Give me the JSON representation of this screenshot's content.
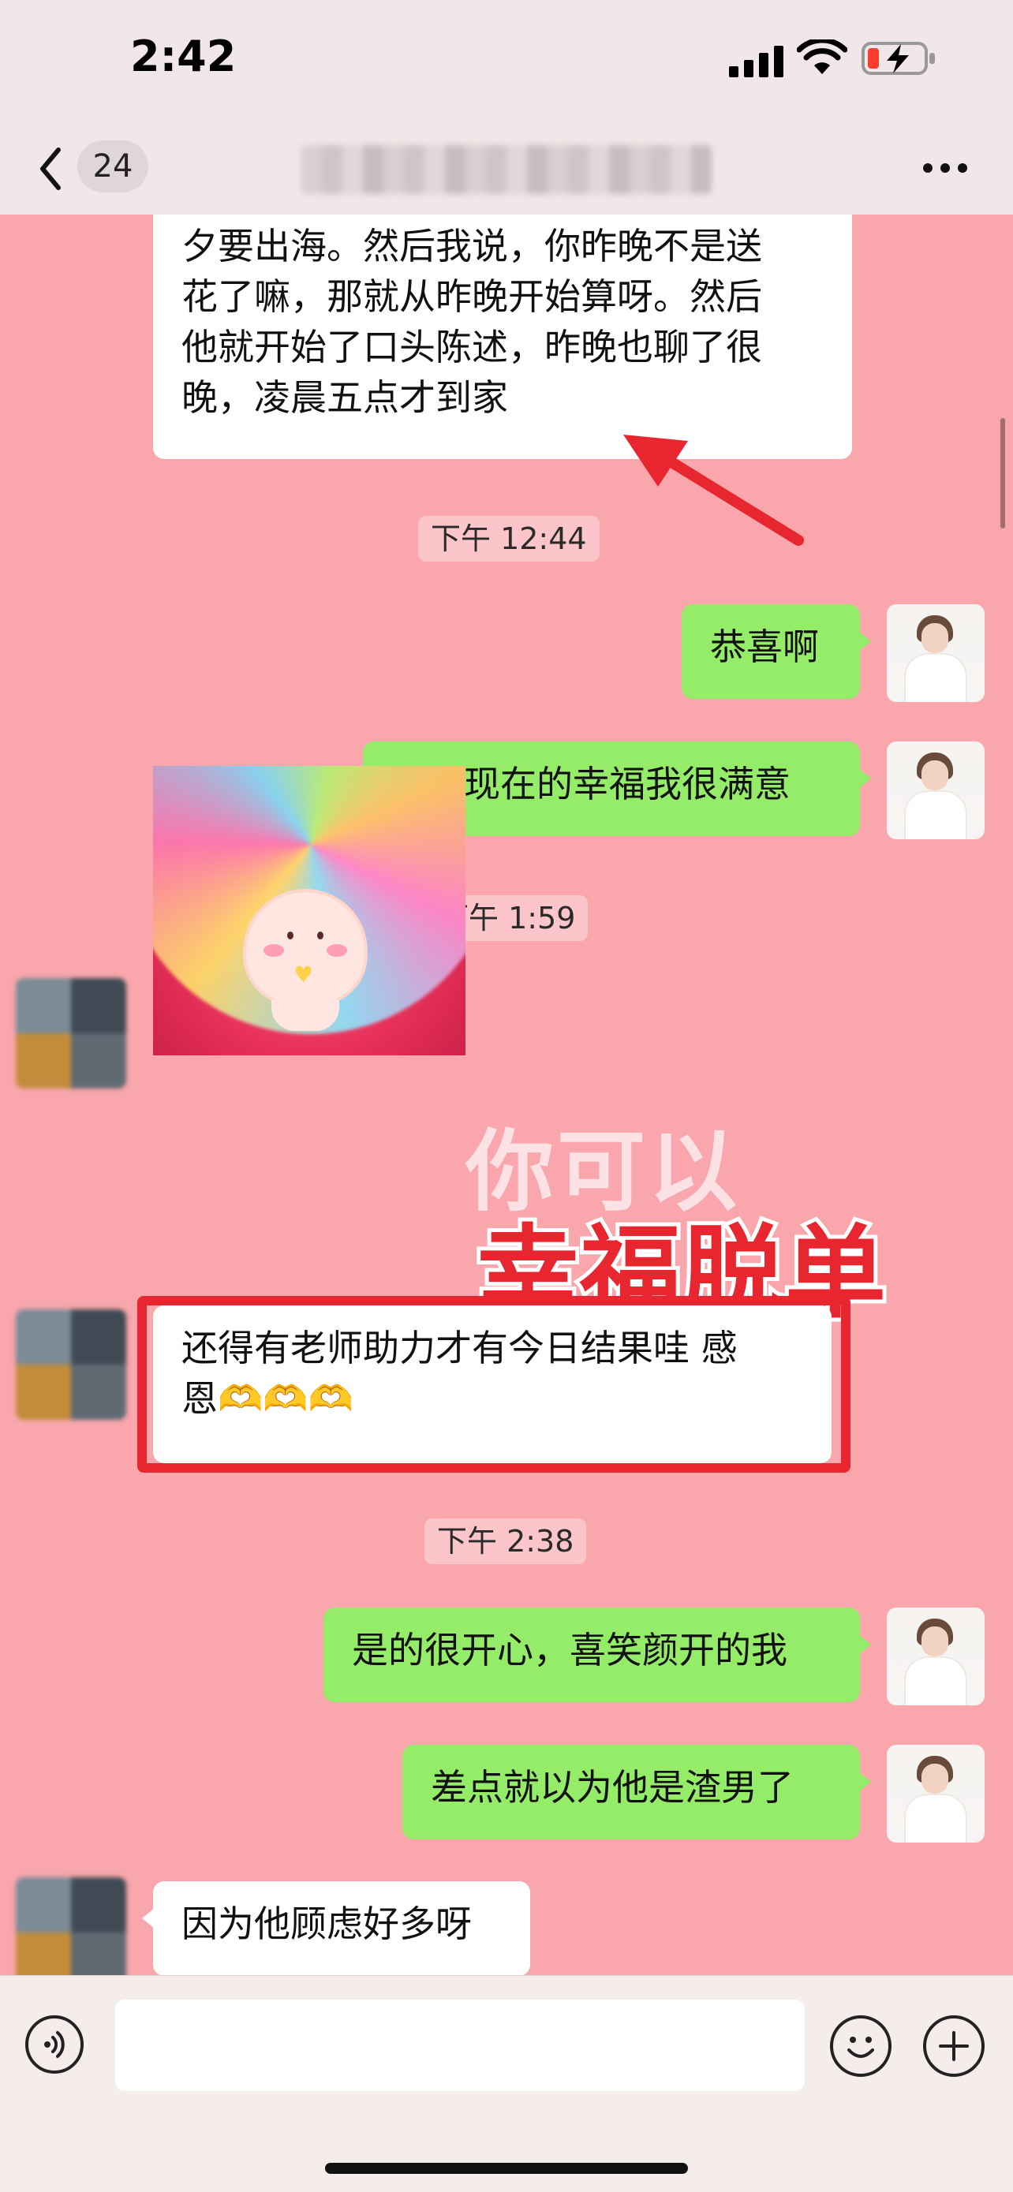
{
  "status_bar": {
    "time": "2:42"
  },
  "nav": {
    "unread_count": "24"
  },
  "timestamps": {
    "t1": "下午 12:44",
    "t2": "下午 1:59",
    "t3": "下午 2:38"
  },
  "messages": {
    "top_bubble_lines": [
      "夕要出海。然后我说，你昨晚不是送",
      "花了嘛，那就从昨晚开始算呀。然后",
      "他就开始了口头陈述，昨晚也聊了很",
      "晚，凌晨五点才到家"
    ],
    "m_congrats": "恭喜啊",
    "m_satisfied": "看你现在的幸福我很满意",
    "m_teacher_line1": "还得有老师助力才有今日结果哇  感",
    "m_teacher_line2": "恩🫶🫶🫶",
    "m_happy": "是的很开心，喜笑颜开的我",
    "m_almost": "差点就以为他是渣男了",
    "m_worry": "因为他顾虑好多呀"
  },
  "overlay": {
    "line1": "你可以",
    "line2": "幸福脱单",
    "accent_color": "#e8262f"
  },
  "colors": {
    "background": "#f9a7ac",
    "self_bubble": "#95ec69",
    "other_bubble": "#ffffff"
  },
  "icons": {
    "back": "chevron-left-icon",
    "more": "more-dots-icon",
    "voice": "voice-icon",
    "emoji": "emoji-icon",
    "plus": "plus-icon"
  }
}
